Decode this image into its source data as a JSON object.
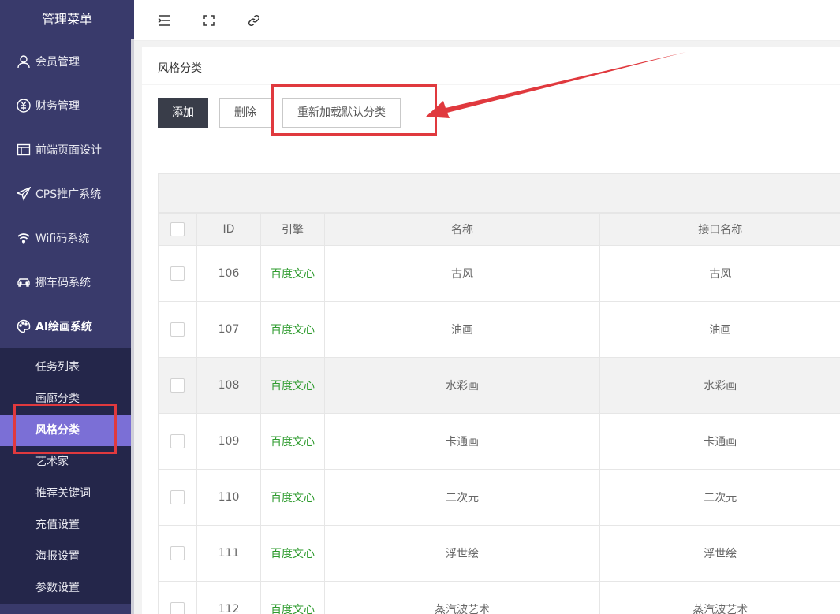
{
  "sidebar": {
    "title": "管理菜单",
    "items": [
      {
        "label": "会员管理",
        "icon": "user-icon"
      },
      {
        "label": "财务管理",
        "icon": "yen-icon"
      },
      {
        "label": "前端页面设计",
        "icon": "layout-icon"
      },
      {
        "label": "CPS推广系统",
        "icon": "send-icon"
      },
      {
        "label": "Wifi码系统",
        "icon": "wifi-icon"
      },
      {
        "label": "挪车码系统",
        "icon": "car-icon"
      },
      {
        "label": "AI绘画系统",
        "icon": "palette-icon"
      }
    ],
    "submenu": [
      "任务列表",
      "画廊分类",
      "风格分类",
      "艺术家",
      "推荐关键词",
      "充值设置",
      "海报设置",
      "参数设置"
    ],
    "active_sub": "风格分类"
  },
  "topbar": {
    "icons": [
      "fold-menu-icon",
      "fullscreen-icon",
      "link-icon"
    ]
  },
  "page": {
    "title": "风格分类",
    "buttons": {
      "add": "添加",
      "delete": "删除",
      "reload": "重新加载默认分类"
    }
  },
  "table": {
    "columns": [
      "ID",
      "引擎",
      "名称",
      "接口名称"
    ],
    "rows": [
      {
        "id": "106",
        "engine": "百度文心",
        "name": "古风",
        "api_name": "古风"
      },
      {
        "id": "107",
        "engine": "百度文心",
        "name": "油画",
        "api_name": "油画"
      },
      {
        "id": "108",
        "engine": "百度文心",
        "name": "水彩画",
        "api_name": "水彩画"
      },
      {
        "id": "109",
        "engine": "百度文心",
        "name": "卡通画",
        "api_name": "卡通画"
      },
      {
        "id": "110",
        "engine": "百度文心",
        "name": "二次元",
        "api_name": "二次元"
      },
      {
        "id": "111",
        "engine": "百度文心",
        "name": "浮世绘",
        "api_name": "浮世绘"
      },
      {
        "id": "112",
        "engine": "百度文心",
        "name": "蒸汽波艺术",
        "api_name": "蒸汽波艺术"
      }
    ]
  },
  "colors": {
    "sidebar_bg": "#393a6b",
    "submenu_bg": "#24264a",
    "active_sub_bg": "#7b6fd6",
    "engine_text": "#2e9b2e",
    "annotation_red": "#e0393e"
  }
}
